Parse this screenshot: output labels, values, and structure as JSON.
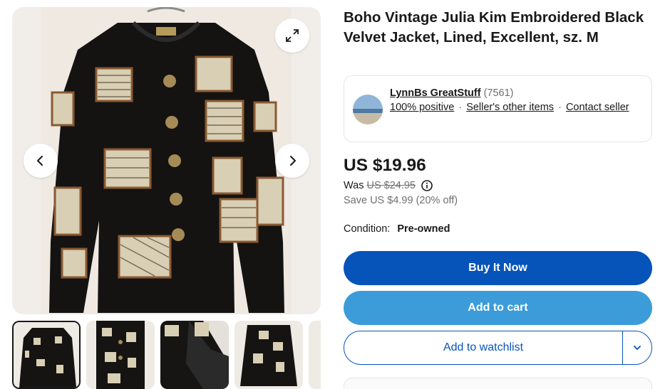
{
  "listing": {
    "title": "Boho Vintage Julia Kim Embroidered Black Velvet Jacket, Lined, Excellent, sz. M"
  },
  "gallery": {
    "main_image": "black velvet embroidered jacket",
    "thumbnail_count": 4,
    "active_thumbnail": 1
  },
  "seller": {
    "name": "LynnBs GreatStuff",
    "feedback_count": "(7561)",
    "positive": "100% positive",
    "other_items": "Seller's other items",
    "contact": "Contact seller",
    "separator": "·"
  },
  "pricing": {
    "price": "US $19.96",
    "was_label": "Was",
    "was_price": "US $24.95",
    "savings": "Save US $4.99 (20% off)"
  },
  "condition": {
    "label": "Condition:",
    "value": "Pre-owned"
  },
  "actions": {
    "buy_now": "Buy It Now",
    "add_to_cart": "Add to cart",
    "add_to_watchlist": "Add to watchlist"
  },
  "colors": {
    "primary_blue": "#0654ba",
    "cart_blue": "#3b9cd9",
    "text": "#191919",
    "muted": "#707070"
  },
  "icons": [
    "expand-icon",
    "chevron-left-icon",
    "chevron-right-icon",
    "info-icon",
    "chevron-down-icon"
  ]
}
